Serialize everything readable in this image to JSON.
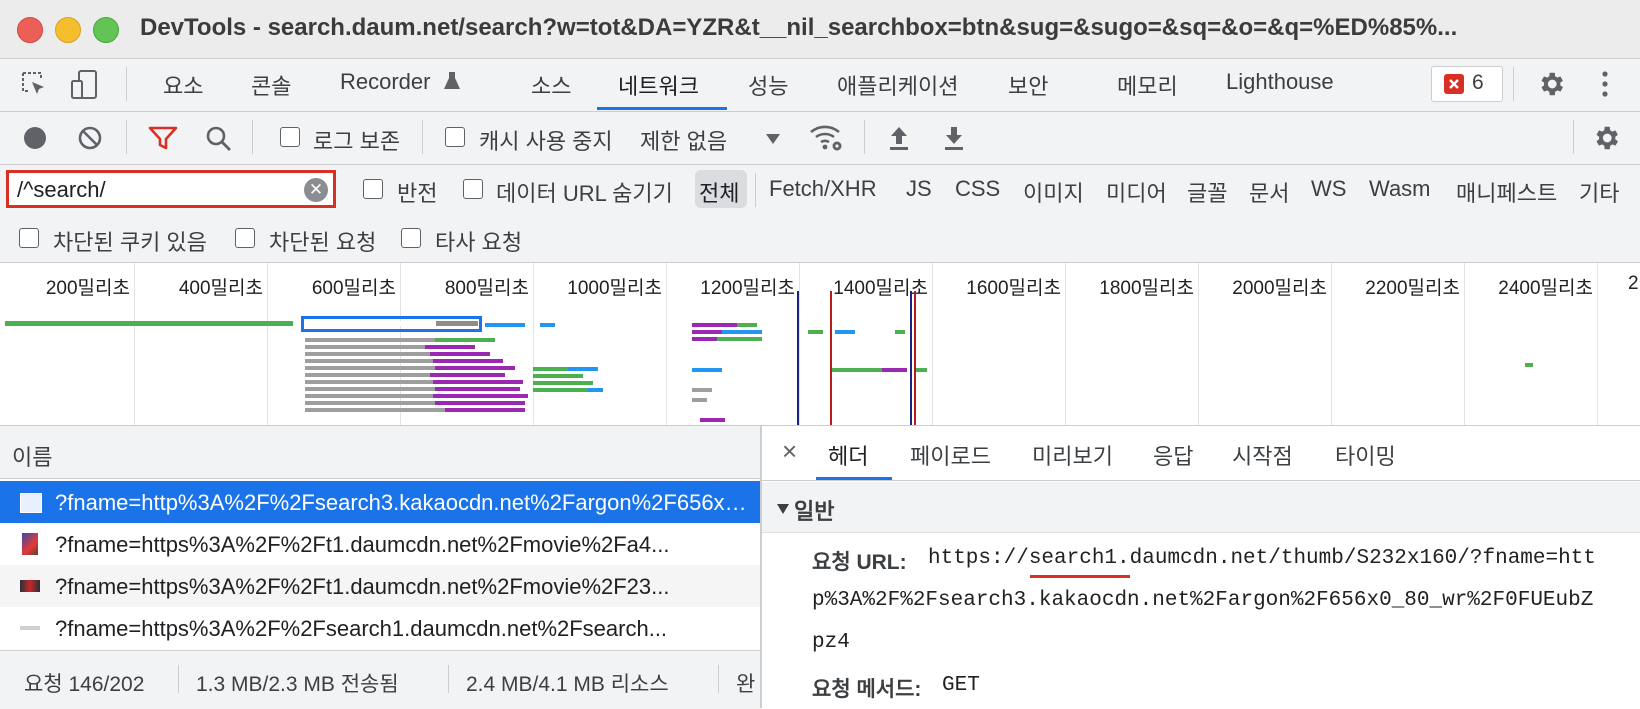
{
  "window": {
    "title": "DevTools - search.daum.net/search?w=tot&DA=YZR&t__nil_searchbox=btn&sug=&sugo=&sq=&o=&q=%ED%85%..."
  },
  "main_tabs": {
    "items": [
      "요소",
      "콘솔",
      "Recorder",
      "소스",
      "네트워크",
      "성능",
      "애플리케이션",
      "보안",
      "메모리",
      "Lighthouse"
    ],
    "active": "네트워크",
    "error_count": "6"
  },
  "toolbar": {
    "preserve_log": "로그 보존",
    "disable_cache": "캐시 사용 중지",
    "throttling": "제한 없음"
  },
  "filter": {
    "value": "/^search/",
    "invert": "반전",
    "hide_data_urls": "데이터 URL 숨기기",
    "types": [
      "전체",
      "Fetch/XHR",
      "JS",
      "CSS",
      "이미지",
      "미디어",
      "글꼴",
      "문서",
      "WS",
      "Wasm",
      "매니페스트",
      "기타"
    ],
    "active_type": "전체",
    "blocked_cookies": "차단된 쿠키 있음",
    "blocked_requests": "차단된 요청",
    "third_party": "타사 요청"
  },
  "timeline": {
    "ticks": [
      "200밀리초",
      "400밀리초",
      "600밀리초",
      "800밀리초",
      "1000밀리초",
      "1200밀리초",
      "1400밀리초",
      "1600밀리초",
      "1800밀리초",
      "2000밀리초",
      "2200밀리초",
      "2400밀리초",
      "2"
    ]
  },
  "requests": {
    "column_name": "이름",
    "rows": [
      "?fname=http%3A%2F%2Fsearch3.kakaocdn.net%2Fargon%2F656x0_80_wr%2F0FUEubZpz4",
      "?fname=https%3A%2F%2Ft1.daumcdn.net%2Fmovie%2Fa4...",
      "?fname=https%3A%2F%2Ft1.daumcdn.net%2Fmovie%2F23...",
      "?fname=https%3A%2F%2Fsearch1.daumcdn.net%2Fsearch..."
    ],
    "selected_index": 0
  },
  "status": {
    "requests": "요청 146/202",
    "transferred": "1.3 MB/2.3 MB 전송됨",
    "resources": "2.4 MB/4.1 MB 리소스",
    "cut": "완"
  },
  "details": {
    "close": "×",
    "tabs": [
      "헤더",
      "페이로드",
      "미리보기",
      "응답",
      "시작점",
      "타이밍"
    ],
    "active_tab": "헤더",
    "section_title": "일반",
    "request_url_key": "요청 URL:",
    "request_url_line1": "https://search1.daumcdn.net/thumb/S232x160/?fname=htt",
    "request_url_line2": "p%3A%2F%2Fsearch3.kakaocdn.net%2Fargon%2F656x0_80_wr%2F0FUEubZ",
    "request_url_line3": "pz4",
    "method_key": "요청 메서드:",
    "method_value": "GET"
  },
  "colors": {
    "accent": "#1a73e8",
    "error": "#d93025",
    "highlight_border": "#d93025"
  }
}
